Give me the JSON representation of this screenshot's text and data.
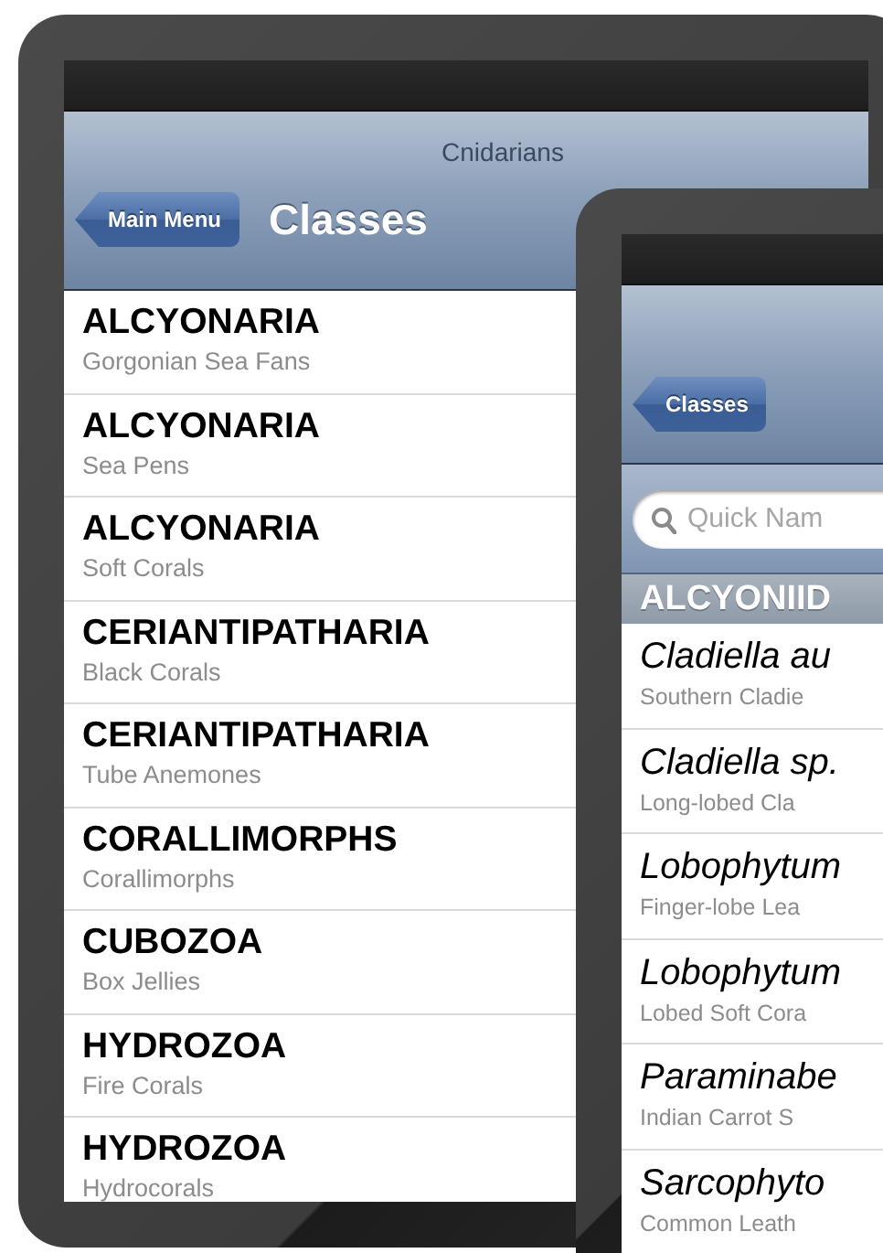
{
  "main_screen": {
    "nav_subtitle": "Cnidarians",
    "back_button": "Main Menu",
    "title": "Classes",
    "items": [
      {
        "title": "ALCYONARIA",
        "subtitle": "Gorgonian Sea Fans"
      },
      {
        "title": "ALCYONARIA",
        "subtitle": "Sea Pens"
      },
      {
        "title": "ALCYONARIA",
        "subtitle": "Soft Corals"
      },
      {
        "title": "CERIANTIPATHARIA",
        "subtitle": "Black Corals"
      },
      {
        "title": "CERIANTIPATHARIA",
        "subtitle": "Tube Anemones"
      },
      {
        "title": "CORALLIMORPHS",
        "subtitle": "Corallimorphs"
      },
      {
        "title": "CUBOZOA",
        "subtitle": "Box Jellies"
      },
      {
        "title": "HYDROZOA",
        "subtitle": "Fire Corals"
      },
      {
        "title": "HYDROZOA",
        "subtitle": "Hydrocorals"
      }
    ]
  },
  "detail_screen": {
    "back_button": "Classes",
    "search": {
      "placeholder": "Quick Nam"
    },
    "section_header": "ALCYONIID",
    "items": [
      {
        "title": "Cladiella au",
        "subtitle": "Southern Cladie"
      },
      {
        "title": "Cladiella sp.",
        "subtitle": "Long-lobed Cla"
      },
      {
        "title": "Lobophytum",
        "subtitle": "Finger-lobe Lea"
      },
      {
        "title": "Lobophytum",
        "subtitle": "Lobed Soft Cora"
      },
      {
        "title": "Paraminabe",
        "subtitle": "Indian Carrot S"
      },
      {
        "title": "Sarcophyto",
        "subtitle": "Common Leath"
      }
    ]
  }
}
